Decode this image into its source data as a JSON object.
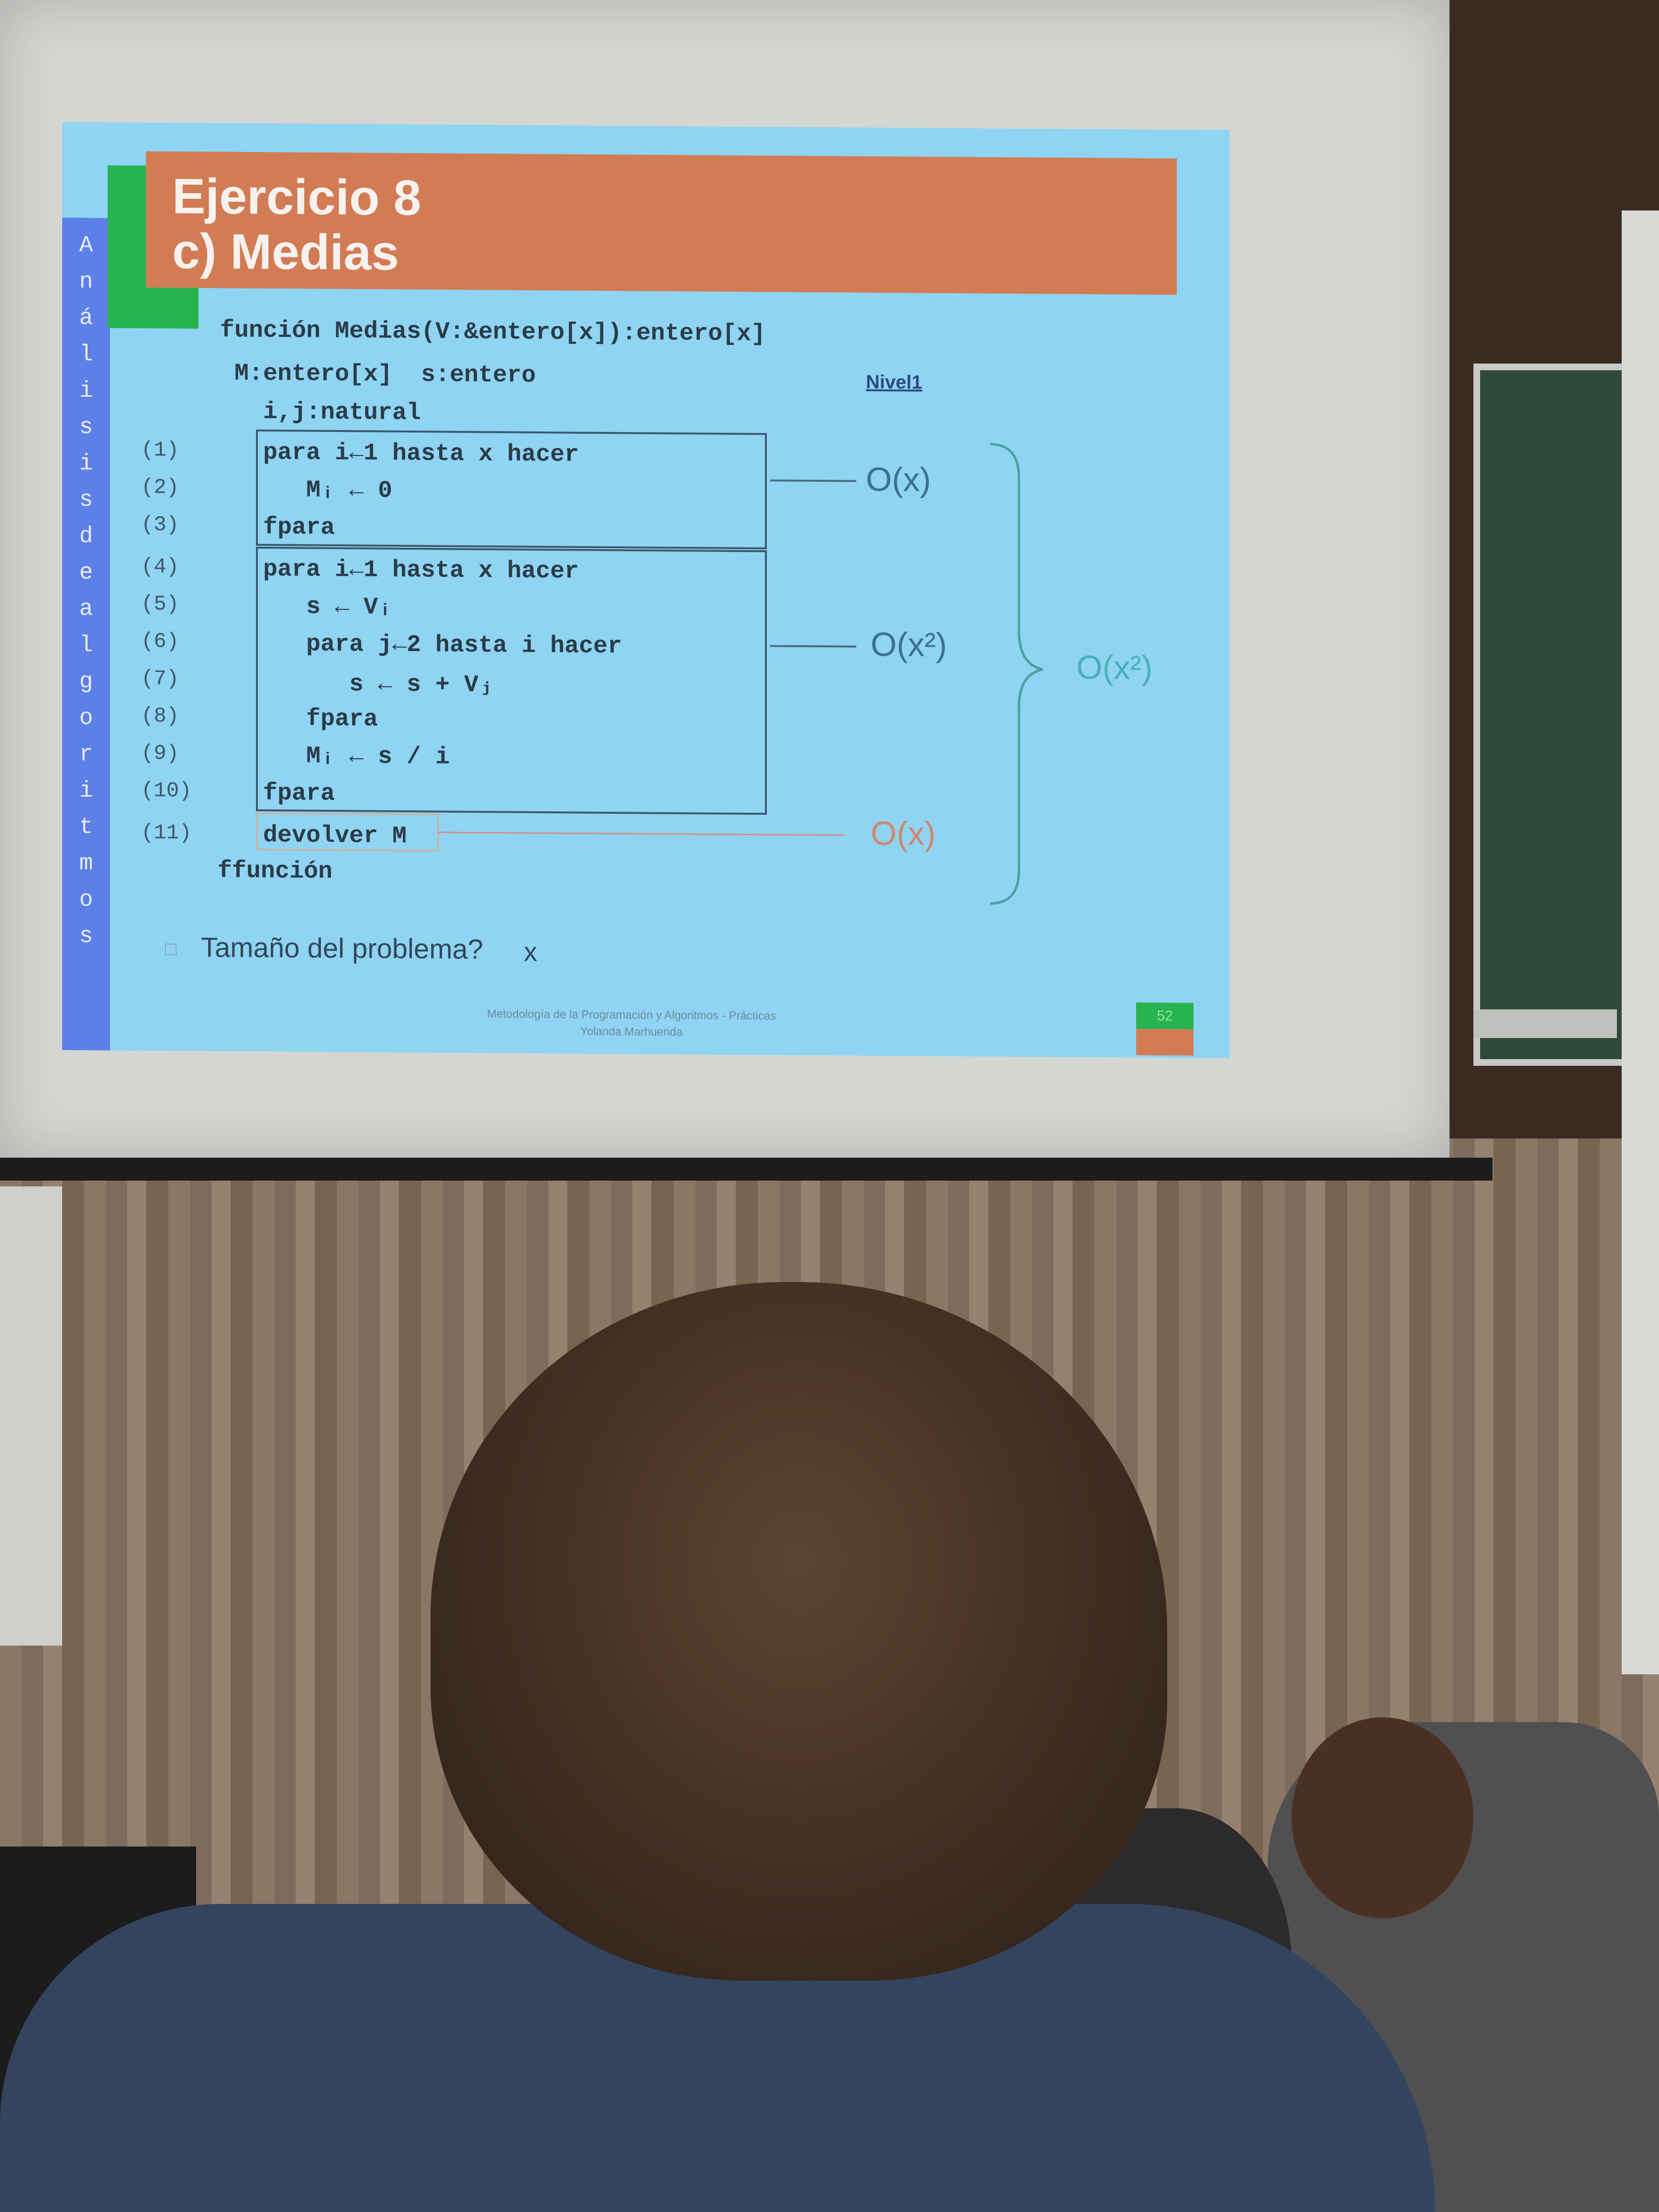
{
  "slide": {
    "title_line1": "Ejercicio 8",
    "title_line2": "c) Medias",
    "side_letters": [
      "A",
      "n",
      "á",
      "l",
      "i",
      "s",
      "i",
      "s",
      "",
      "d",
      "e",
      "",
      "a",
      "l",
      "g",
      "o",
      "r",
      "i",
      "t",
      "m",
      "o",
      "s"
    ],
    "header_code": "función Medias(V:&entero[x]):entero[x]",
    "decl1": "M:entero[x]  s:entero",
    "decl2": "i,j:natural",
    "nivel": "Nivel1",
    "lines": [
      {
        "num": "(1)",
        "code": "para i←1 hasta x hacer"
      },
      {
        "num": "(2)",
        "code": "   Mᵢ ← 0"
      },
      {
        "num": "(3)",
        "code": "fpara"
      },
      {
        "num": "(4)",
        "code": "para i←1 hasta x hacer"
      },
      {
        "num": "(5)",
        "code": "   s ← Vᵢ"
      },
      {
        "num": "(6)",
        "code": "   para j←2 hasta i hacer"
      },
      {
        "num": "(7)",
        "code": "      s ← s + Vⱼ"
      },
      {
        "num": "(8)",
        "code": "   fpara"
      },
      {
        "num": "(9)",
        "code": "   Mᵢ ← s / i"
      },
      {
        "num": "(10)",
        "code": "fpara"
      },
      {
        "num": "(11)",
        "code": "devolver M"
      }
    ],
    "end_code": "ffunción",
    "o1": "O(x)",
    "o2": "O(x²)",
    "o3": "O(x)",
    "o_total": "O(x²)",
    "question_bullet": "□",
    "question": "Tamaño del problema?",
    "answer": "x",
    "footer_line1": "Metodología de la Programación y Algoritmos - Prácticas",
    "footer_line2": "Yolanda Marhuenda",
    "page": "52",
    "colors": {
      "orange": "#d27c55",
      "green": "#27b34d",
      "blue_strip": "#5d7fe8",
      "slide_bg": "#8fd4f2"
    }
  }
}
